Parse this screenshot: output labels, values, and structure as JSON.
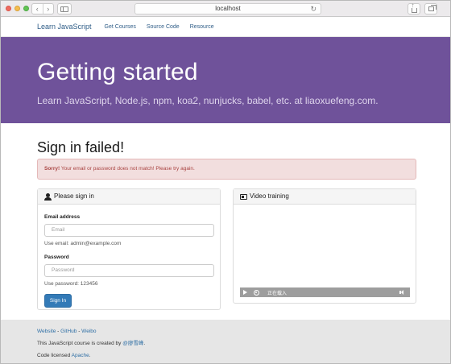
{
  "browser": {
    "address": "localhost"
  },
  "navbar": {
    "brand": "Learn JavaScript",
    "links": [
      "Get Courses",
      "Source Code",
      "Resource"
    ]
  },
  "jumbotron": {
    "title": "Getting started",
    "subtitle": "Learn JavaScript, Node.js, npm, koa2, nunjucks, babel, etc. at liaoxuefeng.com."
  },
  "main": {
    "title": "Sign in failed!",
    "alert": {
      "strong": "Sorry!",
      "message": " Your email or password does not match! Please try again."
    },
    "signin_panel": {
      "heading": "Please sign in",
      "email_label": "Email address",
      "email_placeholder": "Email",
      "email_help": "Use email: admin@example.com",
      "password_label": "Password",
      "password_placeholder": "Password",
      "password_help": "Use password: 123456",
      "button": "Sign In"
    },
    "video_panel": {
      "heading": "Video training",
      "status": "正在载入"
    }
  },
  "footer": {
    "link_website": "Website",
    "sep1": " - ",
    "link_github": "GitHub",
    "sep2": " - ",
    "link_weibo": "Weibo",
    "course_prefix": "This JavaScript course is created by ",
    "author": "@廖雪峰",
    "course_suffix": ".",
    "license_prefix": "Code licensed ",
    "license_link": "Apache",
    "license_suffix": "."
  }
}
